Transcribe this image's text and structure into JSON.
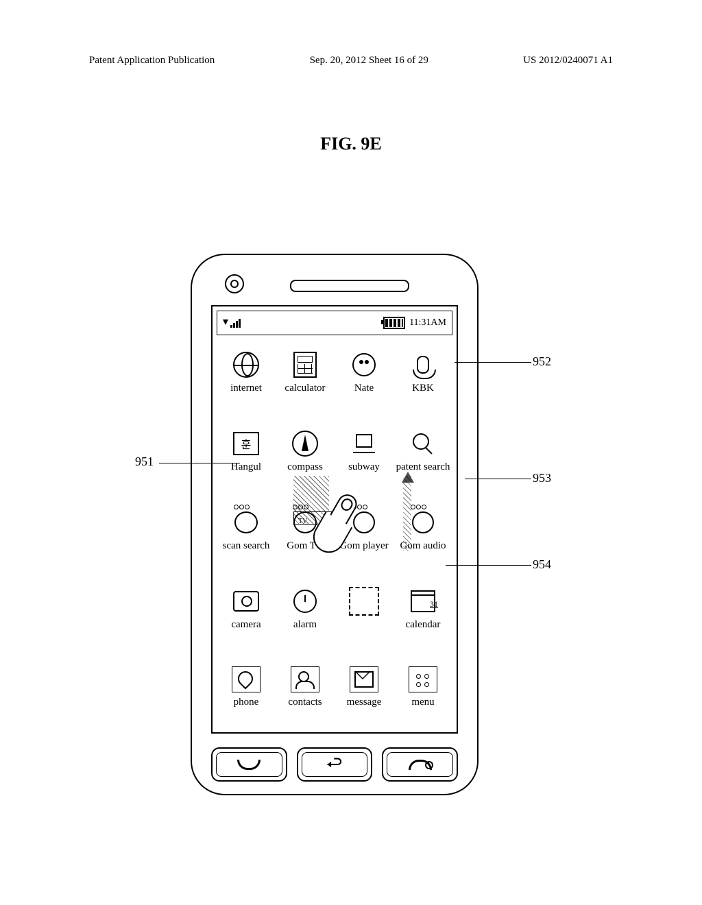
{
  "header": {
    "left": "Patent Application Publication",
    "center": "Sep. 20, 2012  Sheet 16 of 29",
    "right": "US 2012/0240071 A1"
  },
  "figure_label": "FIG. 9E",
  "status": {
    "time": "11:31AM"
  },
  "apps": {
    "row1": [
      {
        "label": "internet"
      },
      {
        "label": "calculator"
      },
      {
        "label": "Nate"
      },
      {
        "label": "KBK"
      }
    ],
    "row2": [
      {
        "label": "Hangul"
      },
      {
        "label": "compass"
      },
      {
        "label": "subway"
      },
      {
        "label": "patent search"
      }
    ],
    "row3": [
      {
        "label": "scan search"
      },
      {
        "label": "Gom TV"
      },
      {
        "label": "Gom player"
      },
      {
        "label": "Gom audio"
      }
    ],
    "row4": [
      {
        "label": "camera"
      },
      {
        "label": "alarm"
      },
      {
        "label": ""
      },
      {
        "label": "calendar"
      }
    ],
    "dock": [
      {
        "label": "phone"
      },
      {
        "label": "contacts"
      },
      {
        "label": "message"
      },
      {
        "label": "menu"
      }
    ]
  },
  "hangul_glyph": "훈",
  "callouts": {
    "c951": "951",
    "c952": "952",
    "c953": "953",
    "c954": "954"
  }
}
